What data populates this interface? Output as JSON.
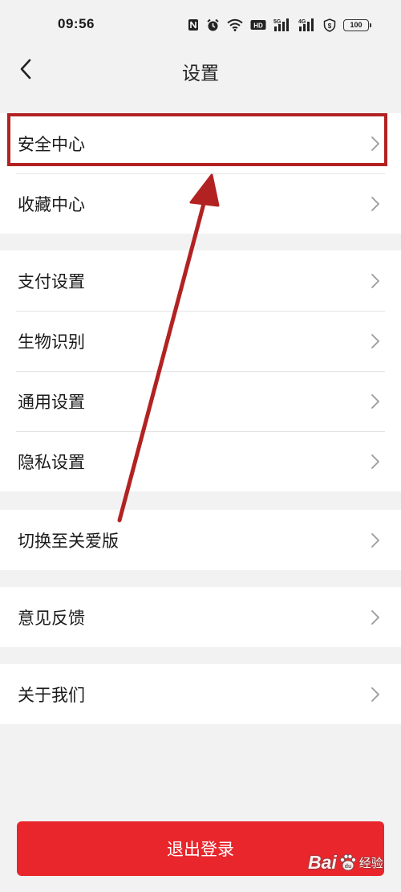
{
  "status_bar": {
    "time": "09:56",
    "battery": "100",
    "icons": [
      "nfc-icon",
      "alarm-icon",
      "wifi-icon",
      "hd-icon",
      "5g-signal-icon",
      "4g-signal-icon",
      "shield-icon",
      "battery-icon"
    ]
  },
  "header": {
    "title": "设置",
    "back_icon": "chevron-left-icon"
  },
  "groups": [
    {
      "items": [
        {
          "label": "安全中心"
        },
        {
          "label": "收藏中心"
        }
      ]
    },
    {
      "items": [
        {
          "label": "支付设置"
        },
        {
          "label": "生物识别"
        },
        {
          "label": "通用设置"
        },
        {
          "label": "隐私设置"
        }
      ]
    },
    {
      "items": [
        {
          "label": "切换至关爱版"
        }
      ]
    },
    {
      "items": [
        {
          "label": "意见反馈"
        }
      ]
    },
    {
      "items": [
        {
          "label": "关于我们"
        }
      ]
    }
  ],
  "logout_label": "退出登录",
  "watermark": {
    "brand": "Bai",
    "brand_suffix": "经验"
  },
  "colors": {
    "accent_red": "#e8262c",
    "annotation_red": "#b32222",
    "background": "#f2f2f2"
  }
}
